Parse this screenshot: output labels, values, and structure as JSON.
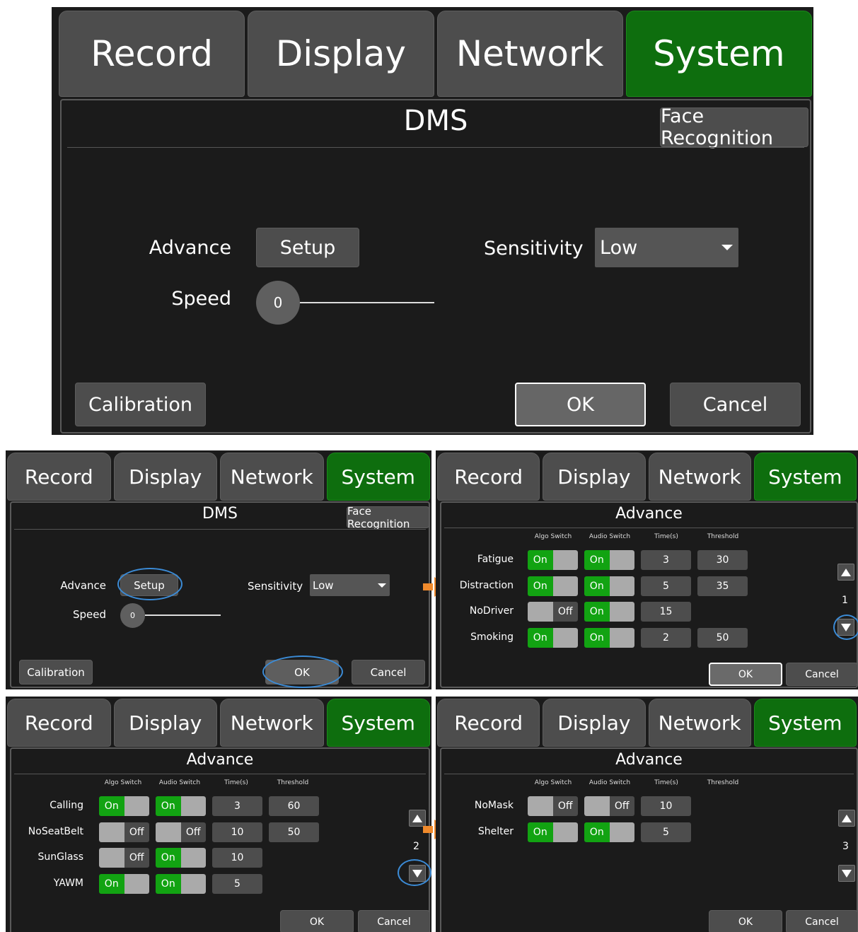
{
  "tabs": [
    "Record",
    "Display",
    "Network",
    "System"
  ],
  "dms": {
    "title": "DMS",
    "face_recognition": "Face Recognition",
    "advance_label": "Advance",
    "setup_label": "Setup",
    "sensitivity_label": "Sensitivity",
    "sensitivity_value": "Low",
    "speed_label": "Speed",
    "speed_value": "0",
    "calibration": "Calibration",
    "ok": "OK",
    "cancel": "Cancel"
  },
  "advance": {
    "title": "Advance",
    "col_algo": "Algo Switch",
    "col_audio": "Audio Switch",
    "col_time": "Time(s)",
    "col_threshold": "Threshold",
    "on": "On",
    "off": "Off",
    "ok": "OK",
    "cancel": "Cancel",
    "pages": [
      {
        "page": "1",
        "rows": [
          {
            "name": "Fatigue",
            "algo": "On",
            "audio": "On",
            "time": "3",
            "threshold": "30"
          },
          {
            "name": "Distraction",
            "algo": "On",
            "audio": "On",
            "time": "5",
            "threshold": "35"
          },
          {
            "name": "NoDriver",
            "algo": "Off",
            "audio": "On",
            "time": "15",
            "threshold": ""
          },
          {
            "name": "Smoking",
            "algo": "On",
            "audio": "On",
            "time": "2",
            "threshold": "50"
          }
        ]
      },
      {
        "page": "2",
        "rows": [
          {
            "name": "Calling",
            "algo": "On",
            "audio": "On",
            "time": "3",
            "threshold": "60"
          },
          {
            "name": "NoSeatBelt",
            "algo": "Off",
            "audio": "Off",
            "time": "10",
            "threshold": "50"
          },
          {
            "name": "SunGlass",
            "algo": "Off",
            "audio": "On",
            "time": "10",
            "threshold": ""
          },
          {
            "name": "YAWM",
            "algo": "On",
            "audio": "On",
            "time": "5",
            "threshold": ""
          }
        ]
      },
      {
        "page": "3",
        "rows": [
          {
            "name": "NoMask",
            "algo": "Off",
            "audio": "Off",
            "time": "10",
            "threshold": ""
          },
          {
            "name": "Shelter",
            "algo": "On",
            "audio": "On",
            "time": "5",
            "threshold": ""
          }
        ]
      }
    ]
  },
  "colors": {
    "active_tab": "#0e6e0e",
    "toggle_on": "#12a312",
    "highlight_ring": "#3b8bd6",
    "flow_arrow": "#f08a2c"
  }
}
